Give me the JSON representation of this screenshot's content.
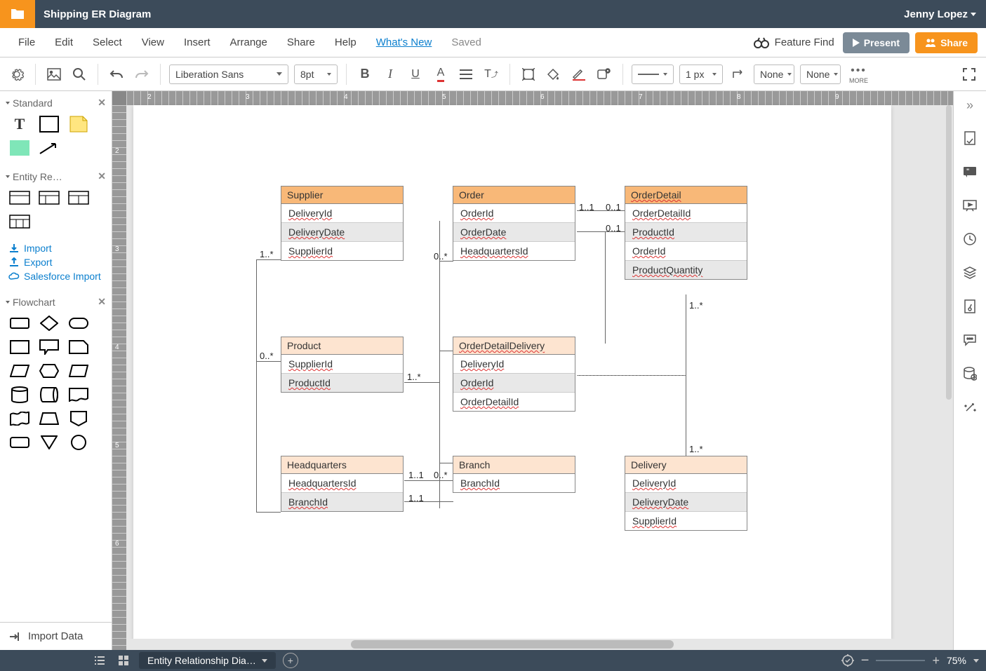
{
  "titlebar": {
    "title": "Shipping ER Diagram",
    "user": "Jenny Lopez"
  },
  "menubar": {
    "items": [
      "File",
      "Edit",
      "Select",
      "View",
      "Insert",
      "Arrange",
      "Share",
      "Help"
    ],
    "whatsnew": "What's New",
    "saved": "Saved",
    "featurefind": "Feature Find",
    "present": "Present",
    "share": "Share"
  },
  "toolbar": {
    "font": "Liberation Sans",
    "fontsize": "8pt",
    "linewidth": "1 px",
    "lineopt1": "None",
    "lineopt2": "None",
    "more": "MORE"
  },
  "sidebar": {
    "sections": [
      {
        "title": "Standard"
      },
      {
        "title": "Entity Re…"
      },
      {
        "title": "Flowchart"
      }
    ],
    "links": {
      "import": "Import",
      "export": "Export",
      "import2": "Salesforce Import"
    },
    "importdata": "Import Data"
  },
  "entities": {
    "supplier": {
      "title": "Supplier",
      "rows": [
        "DeliveryId",
        "DeliveryDate",
        "SupplierId"
      ]
    },
    "order": {
      "title": "Order",
      "rows": [
        "OrderId",
        "OrderDate",
        "HeadquartersId"
      ]
    },
    "orderdetail": {
      "title": "OrderDetail",
      "rows": [
        "OrderDetailId",
        "ProductId",
        "OrderId",
        "ProductQuantity"
      ]
    },
    "product": {
      "title": "Product",
      "rows": [
        "SupplierId",
        "ProductId"
      ]
    },
    "orderdetaildelivery": {
      "title": "OrderDetailDelivery",
      "rows": [
        "DeliveryId",
        "OrderId",
        "OrderDetailId"
      ]
    },
    "headquarters": {
      "title": "Headquarters",
      "rows": [
        "HeadquartersId",
        "BranchId"
      ]
    },
    "branch": {
      "title": "Branch",
      "rows": [
        "BranchId"
      ]
    },
    "delivery": {
      "title": "Delivery",
      "rows": [
        "DeliveryId",
        "DeliveryDate",
        "SupplierId"
      ]
    }
  },
  "labels": {
    "l1": "1..*",
    "l2": "0..*",
    "l3": "1..*",
    "l4": "1..1",
    "l5": "0..1",
    "l6": "0..1",
    "l7": "0..*",
    "l8": "1..1",
    "l9": "1..1",
    "l10": "0..*",
    "l11": "1..*",
    "l12": "1..*"
  },
  "bottombar": {
    "tab": "Entity Relationship Dia…",
    "zoom": "75%"
  },
  "ruler": {
    "h": [
      "2",
      "3",
      "4",
      "5",
      "6",
      "7",
      "8",
      "9"
    ],
    "v": [
      "2",
      "3",
      "4",
      "5",
      "6"
    ]
  }
}
